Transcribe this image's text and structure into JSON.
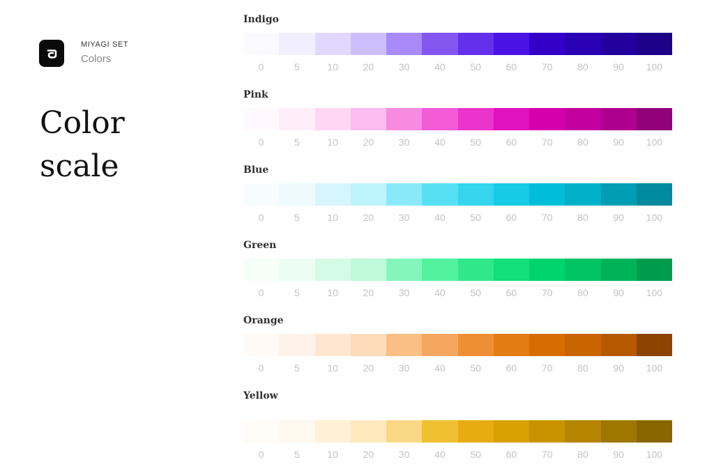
{
  "brand": {
    "set_name": "MIYAGI SET",
    "subtitle": "Colors",
    "logo_icon": "spiral-logo-icon"
  },
  "page": {
    "title": "Color scale"
  },
  "steps": [
    "0",
    "5",
    "10",
    "20",
    "30",
    "40",
    "50",
    "60",
    "70",
    "80",
    "90",
    "100"
  ],
  "scales": [
    {
      "name": "Indigo",
      "colors": [
        "#fbfaff",
        "#f1efff",
        "#e1d8ff",
        "#cdbfff",
        "#a88af8",
        "#8456f0",
        "#6430ea",
        "#4b12e6",
        "#3400c8",
        "#2a00b4",
        "#23009e",
        "#1d0088"
      ]
    },
    {
      "name": "Pink",
      "colors": [
        "#fff8fd",
        "#ffeefa",
        "#ffd7f5",
        "#fcbcef",
        "#f78ae1",
        "#f35ad6",
        "#ea34cb",
        "#e011bf",
        "#d400ad",
        "#c3009f",
        "#ad008f",
        "#92007a"
      ]
    },
    {
      "name": "Blue",
      "colors": [
        "#f7fdff",
        "#eefbfe",
        "#d5f6fc",
        "#bff3fb",
        "#8ae9f8",
        "#57e0f3",
        "#34d5ed",
        "#17cbe6",
        "#00bdda",
        "#00b0c9",
        "#009db5",
        "#008a9f"
      ]
    },
    {
      "name": "Green",
      "colors": [
        "#f6fefa",
        "#ecfdf4",
        "#d4fbe6",
        "#bff9da",
        "#85f6bb",
        "#52f29f",
        "#2ee88a",
        "#12de7a",
        "#00d46d",
        "#00c463",
        "#00b359",
        "#009c4d"
      ]
    },
    {
      "name": "Orange",
      "colors": [
        "#fffaf6",
        "#fff2e8",
        "#ffe7d2",
        "#fddcb9",
        "#f9bf85",
        "#f5a660",
        "#ee8f35",
        "#e47c14",
        "#d76d00",
        "#c86500",
        "#b55a00",
        "#8d4300"
      ]
    },
    {
      "name": "Yellow",
      "colors": [
        "#fffcf8",
        "#fff8ee",
        "#fff0d6",
        "#feeabd",
        "#fad986",
        "#efc032",
        "#e6ac12",
        "#d8a000",
        "#c99300",
        "#b58500",
        "#9f7600",
        "#8a6600"
      ]
    }
  ]
}
